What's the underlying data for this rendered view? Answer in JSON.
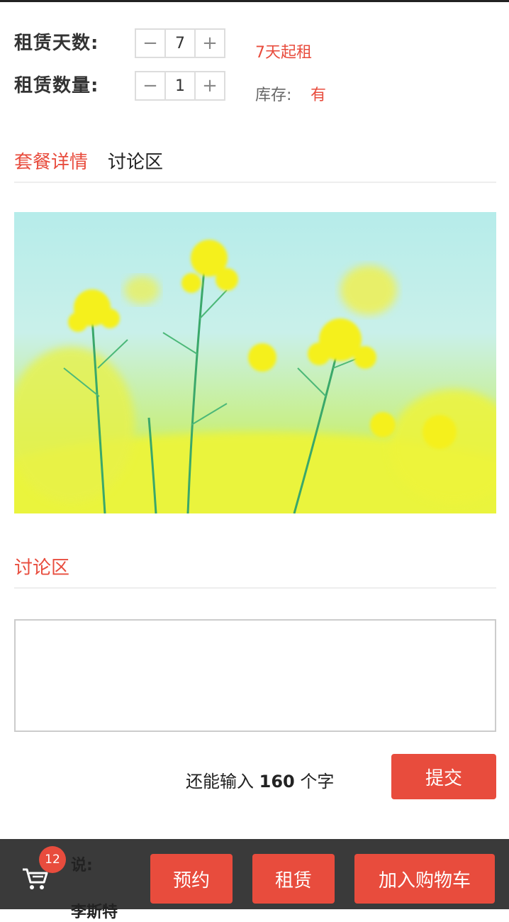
{
  "rental": {
    "days_label": "租赁天数:",
    "days_value": "7",
    "min_note": "7天起租",
    "qty_label": "租赁数量:",
    "qty_value": "1",
    "stock_label": "库存:",
    "stock_value": "有",
    "minus": "−",
    "plus": "+"
  },
  "tabs": [
    {
      "label": "套餐详情",
      "active": true
    },
    {
      "label": "讨论区",
      "active": false
    }
  ],
  "discussion": {
    "title": "讨论区",
    "textarea_value": "",
    "counter_prefix": "还能输入",
    "counter_value": "160",
    "counter_suffix": "个字",
    "submit_label": "提交"
  },
  "bottom_bar": {
    "cart_count": "12",
    "ghost_text_1": "说:",
    "ghost_text_2": "李斯特",
    "reserve_label": "预约",
    "rent_label": "租赁",
    "add_cart_label": "加入购物车"
  },
  "colors": {
    "accent": "#e84c3d",
    "bottom_bar": "#3a3a3a"
  },
  "icons": {
    "cart": "cart-icon"
  }
}
